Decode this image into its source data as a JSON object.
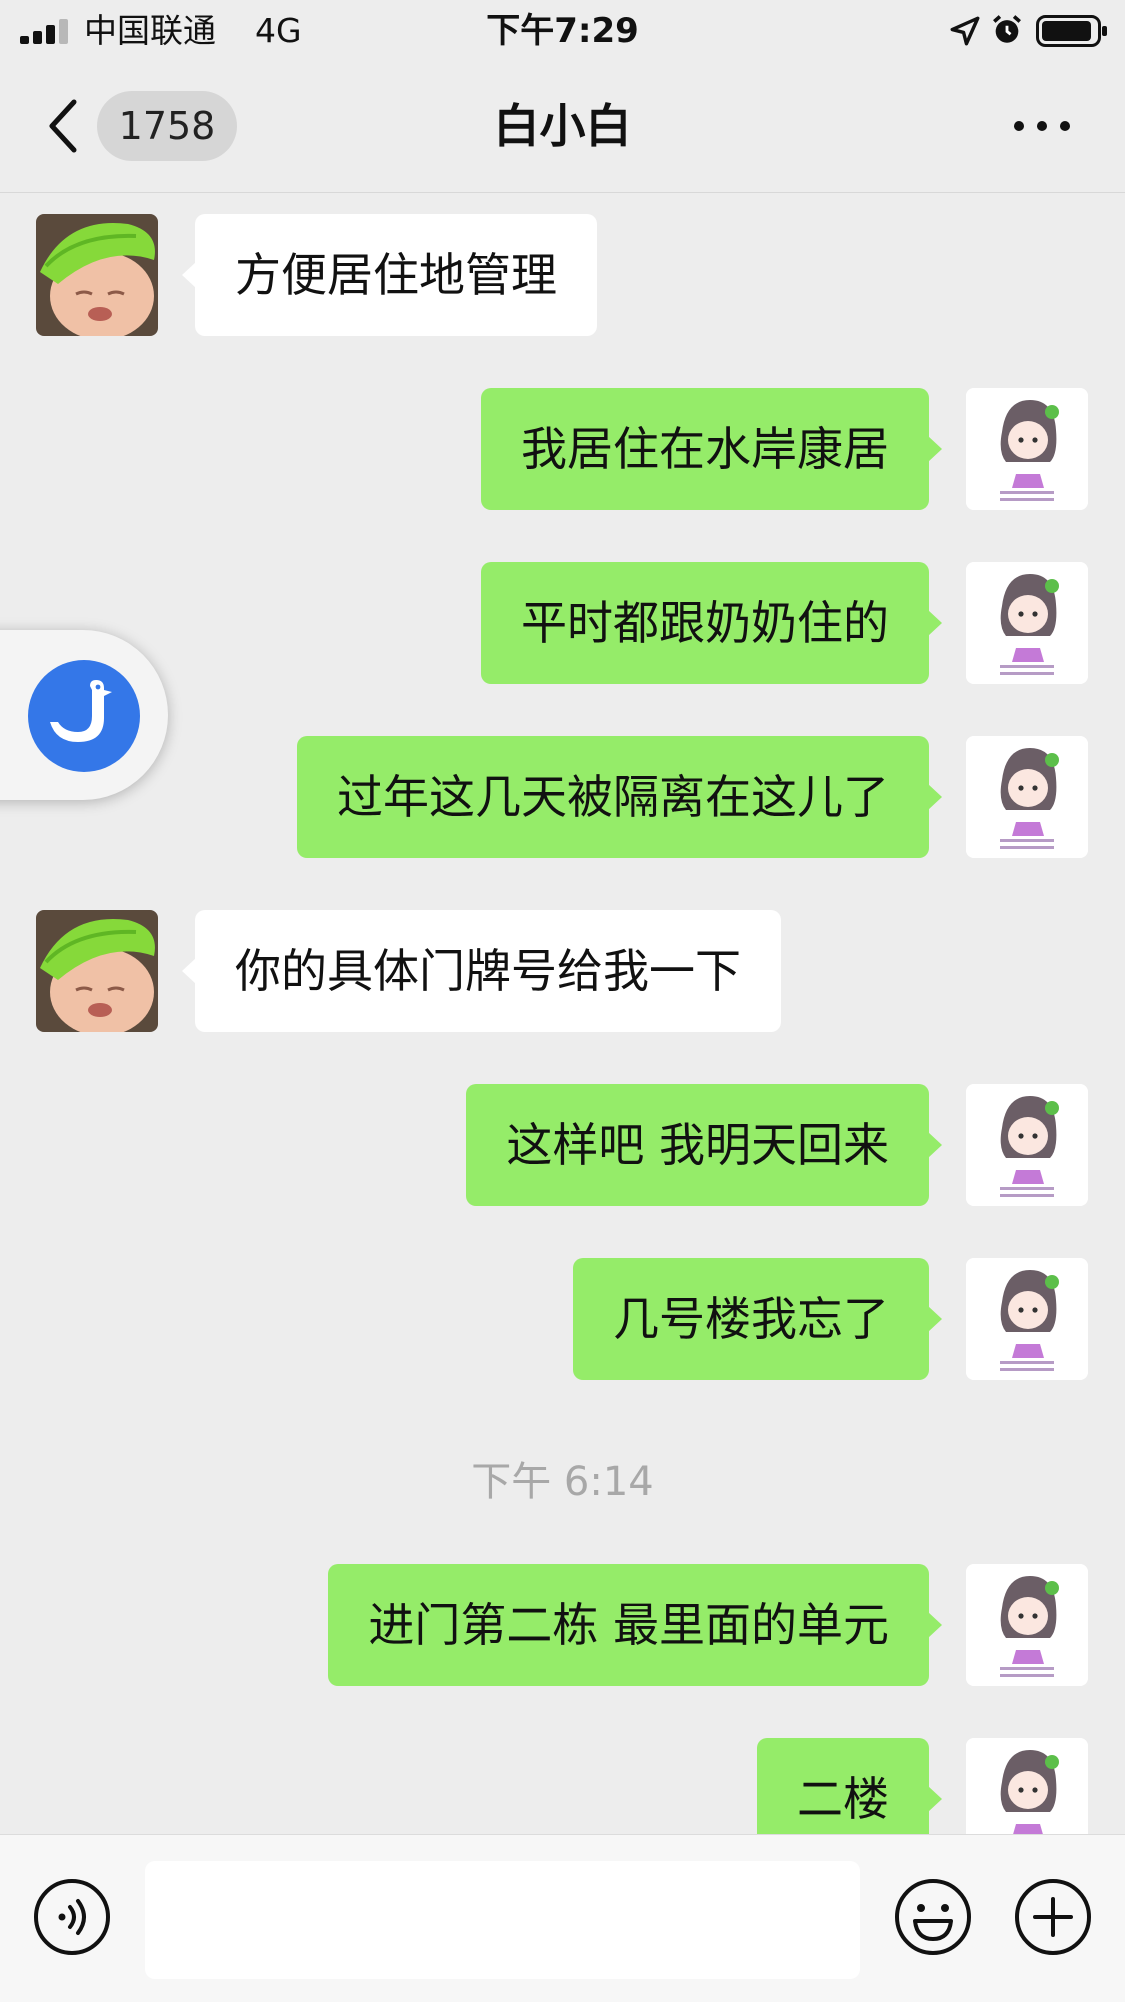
{
  "status_bar": {
    "carrier": "中国联通",
    "network": "4G",
    "time": "下午7:29"
  },
  "nav": {
    "unread_count": "1758",
    "title": "白小白"
  },
  "messages": [
    {
      "side": "left",
      "text": "方便居住地管理"
    },
    {
      "side": "right",
      "text": "我居住在水岸康居"
    },
    {
      "side": "right",
      "text": "平时都跟奶奶住的"
    },
    {
      "side": "right",
      "text": "过年这几天被隔离在这儿了"
    },
    {
      "side": "left",
      "text": "你的具体门牌号给我一下"
    },
    {
      "side": "right",
      "text": "这样吧 我明天回来"
    },
    {
      "side": "right",
      "text": "几号楼我忘了"
    },
    {
      "side": "right",
      "text": "进门第二栋 最里面的单元"
    },
    {
      "side": "right",
      "text": "二楼"
    }
  ],
  "timestamp": "下午 6:14",
  "input": {
    "placeholder": ""
  },
  "colors": {
    "background": "#ededed",
    "outgoing_bubble": "#95ec69",
    "incoming_bubble": "#ffffff",
    "float_icon": "#3477e8"
  },
  "icons": {
    "back": "chevron-left-icon",
    "more": "more-dots-icon",
    "voice": "voice-icon",
    "emoji": "emoji-icon",
    "plus": "plus-icon",
    "float": "goose-icon"
  }
}
